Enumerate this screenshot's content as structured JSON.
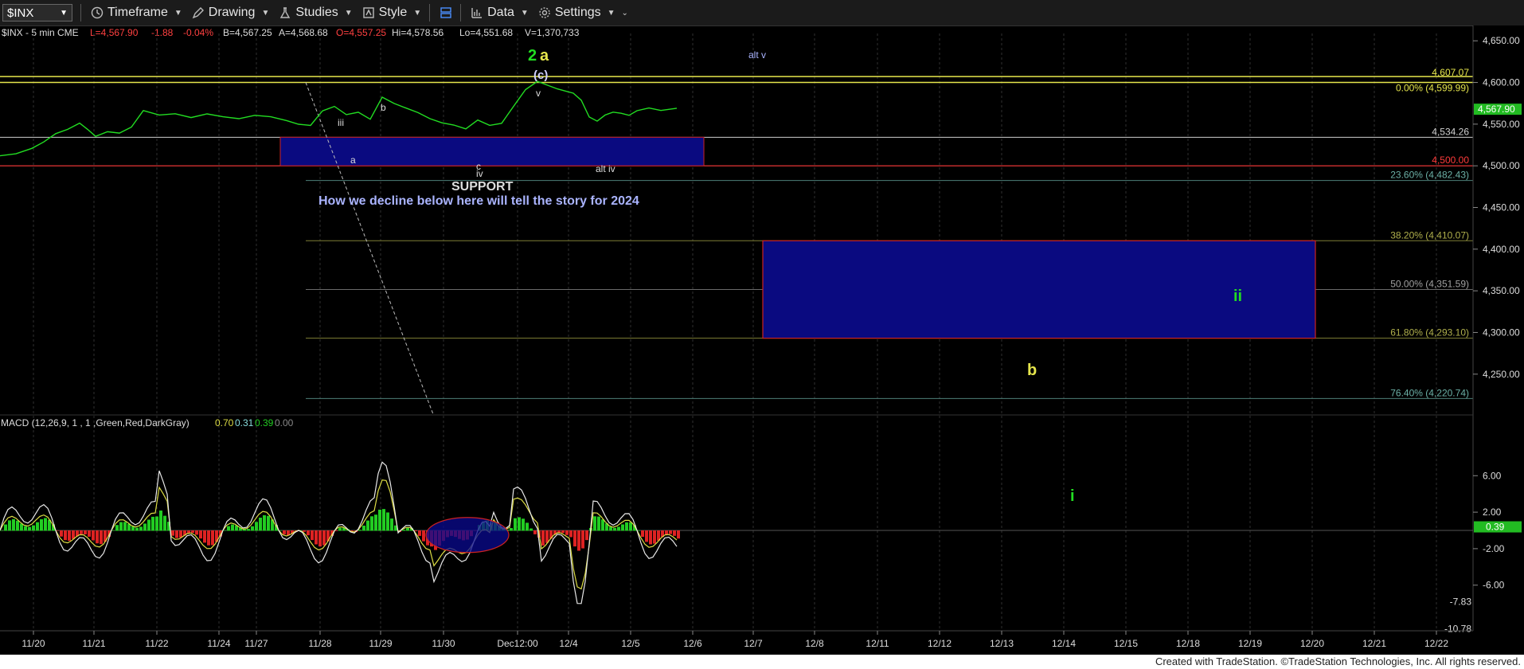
{
  "toolbar": {
    "symbol": "$INX",
    "timeframe": "Timeframe",
    "drawing": "Drawing",
    "studies": "Studies",
    "style": "Style",
    "data": "Data",
    "settings": "Settings"
  },
  "header": {
    "symbol_info": "$INX - 5 min  CME",
    "last": "L=4,567.90",
    "change": "-1.88",
    "pct": "-0.04%",
    "bid": "B=4,567.25",
    "ask": "A=4,568.68",
    "open": "O=4,557.25",
    "high": "Hi=4,578.56",
    "low": "Lo=4,551.68",
    "volume": "V=1,370,733"
  },
  "macd_header": {
    "label": "MACD (12,26,9, 1 , 1 ,Green,Red,DarkGray)",
    "v1": "0.70",
    "v2": "0.31",
    "v3": "0.39",
    "v4": "0.00"
  },
  "footer": {
    "text": "Created with TradeStation. ©TradeStation Technologies, Inc. All rights reserved."
  },
  "chart_data": {
    "type": "line",
    "price_axis": {
      "ticks": [
        "4,650.00",
        "4,600.00",
        "4,550.00",
        "4,500.00",
        "4,450.00",
        "4,400.00",
        "4,350.00",
        "4,300.00",
        "4,250.00"
      ],
      "tick_values": [
        4650,
        4600,
        4550,
        4500,
        4450,
        4400,
        4350,
        4300,
        4250
      ],
      "ylim": [
        4202,
        4655
      ]
    },
    "macd_axis": {
      "ticks": [
        "6.00",
        "2.00",
        "-2.00",
        "-6.00"
      ],
      "tick_values": [
        6,
        2,
        -2,
        -6
      ],
      "ylim": [
        -11,
        11
      ],
      "extra_labels": [
        {
          "text": "-7.83",
          "value": -7.83
        },
        {
          "text": "-10.78",
          "value": -10.78
        }
      ]
    },
    "x_labels": [
      "11/20",
      "11/21",
      "11/22",
      "11/24",
      "11/27",
      "11/28",
      "11/29",
      "11/30",
      "Dec12:00",
      "12/4",
      "12/5",
      "12/6",
      "12/7",
      "12/8",
      "12/11",
      "12/12",
      "12/13",
      "12/14",
      "12/15",
      "12/18",
      "12/19",
      "12/20",
      "12/21",
      "12/22"
    ],
    "price_series": {
      "name": "$INX",
      "color": "#22dd22",
      "x": [
        0,
        20,
        40,
        55,
        70,
        85,
        100,
        110,
        120,
        135,
        150,
        165,
        180,
        200,
        220,
        240,
        260,
        280,
        300,
        320,
        340,
        360,
        375,
        390,
        405,
        420,
        435,
        450,
        465,
        480,
        495,
        510,
        525,
        540,
        555,
        570,
        585,
        600,
        615,
        630,
        645,
        660,
        675,
        690,
        700,
        710,
        720,
        730,
        740,
        750,
        760,
        770,
        780,
        790,
        800,
        815,
        830,
        850
      ],
      "y": [
        4512,
        4515,
        4522,
        4530,
        4540,
        4545,
        4552,
        4544,
        4535,
        4540,
        4538,
        4545,
        4565,
        4560,
        4562,
        4558,
        4563,
        4560,
        4558,
        4562,
        4560,
        4555,
        4550,
        4548,
        4565,
        4570,
        4560,
        4563,
        4555,
        4582,
        4575,
        4570,
        4565,
        4558,
        4553,
        4550,
        4545,
        4555,
        4548,
        4550,
        4570,
        4590,
        4600,
        4595,
        4592,
        4590,
        4588,
        4580,
        4560,
        4555,
        4562,
        4565,
        4563,
        4560,
        4565,
        4568,
        4565,
        4567.9
      ]
    },
    "macd_series": {
      "macd_line": {
        "color": "#e8e8e8"
      },
      "signal_line": {
        "color": "#dddd44"
      },
      "histogram": {
        "pos_color": "#22cc22",
        "neg_color": "#dd2222"
      }
    },
    "right_labels": [
      {
        "text": "4,607.07",
        "value": 4607.07,
        "color": "#e6e64c"
      },
      {
        "text": "0.00% (4,599.99)",
        "value": 4599.99,
        "color": "#e6e64c"
      },
      {
        "text": "4,567.90",
        "value": 4567.9,
        "color": "#ffffff"
      },
      {
        "text": "4,534.26",
        "value": 4534.26,
        "color": "#d0d0d0"
      },
      {
        "text": "4,500.00",
        "value": 4500.0,
        "color": "#ff3b3b"
      },
      {
        "text": "23.60% (4,482.43)",
        "value": 4482.43,
        "color": "#6bb0a6"
      },
      {
        "text": "38.20% (4,410.07)",
        "value": 4410.07,
        "color": "#b0b04c"
      },
      {
        "text": "50.00% (4,351.59)",
        "value": 4351.59,
        "color": "#a0a0a0"
      },
      {
        "text": "61.80% (4,293.10)",
        "value": 4293.1,
        "color": "#b0b04c"
      },
      {
        "text": "76.40% (4,220.74)",
        "value": 4220.74,
        "color": "#6bb0a6"
      }
    ],
    "annotations": [
      {
        "text": "2",
        "color": "#22dd22"
      },
      {
        "text": "a",
        "color": "#e6e64c"
      },
      {
        "text": "(c)",
        "color": "#d0d0ff"
      },
      {
        "text": "alt v",
        "color": "#aab4ff"
      },
      {
        "text": "iii",
        "color": "#dddddd"
      },
      {
        "text": "b",
        "color": "#dddddd"
      },
      {
        "text": "a",
        "color": "#dddddd"
      },
      {
        "text": "c",
        "color": "#dddddd"
      },
      {
        "text": "iv",
        "color": "#dddddd"
      },
      {
        "text": "v",
        "color": "#dddddd"
      },
      {
        "text": "alt iv",
        "color": "#dddddd"
      },
      {
        "text": "SUPPORT",
        "color": "#dddddd"
      },
      {
        "text": "How we decline below here will tell the story for 2024",
        "color": "#aab4ff"
      },
      {
        "text": "ii",
        "color": "#22dd22"
      },
      {
        "text": "b",
        "color": "#e6e64c"
      },
      {
        "text": "i",
        "color": "#22dd22"
      }
    ]
  }
}
